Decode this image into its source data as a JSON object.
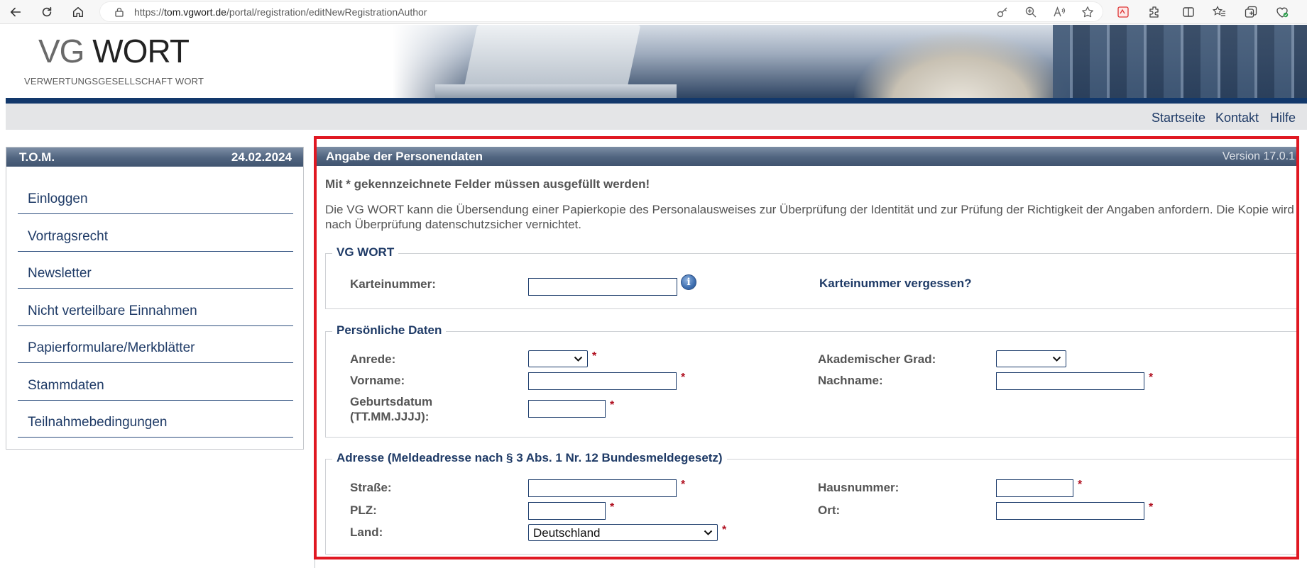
{
  "browser": {
    "url_prefix": "https://",
    "url_host": "tom.vgwort.de",
    "url_path": "/portal/registration/editNewRegistrationAuthor"
  },
  "header": {
    "logo_vg": "VG",
    "logo_wort": "WORT",
    "logo_subtitle": "VERWERTUNGSGESELLSCHAFT WORT"
  },
  "top_nav": {
    "items": [
      "Startseite",
      "Kontakt",
      "Hilfe"
    ]
  },
  "sidebar": {
    "title": "T.O.M.",
    "date": "24.02.2024",
    "items": [
      "Einloggen",
      "Vortragsrecht",
      "Newsletter",
      "Nicht verteilbare Einnahmen",
      "Papierformulare/Merkblätter",
      "Stammdaten",
      "Teilnahmebedingungen"
    ]
  },
  "main": {
    "title": "Angabe der Personendaten",
    "version": "Version 17.0.1",
    "required_note": "Mit * gekennzeichnete Felder müssen ausgefüllt werden!",
    "intro": "Die VG WORT kann die Übersendung einer Papierkopie des Personalausweises zur Überprüfung der Identität und zur Prüfung der Richtigkeit der Angaben anfordern. Die Kopie wird nach Überprüfung datenschutzsicher vernichtet.",
    "required_mark": "*",
    "info_glyph": "i",
    "vgwort_section": {
      "legend": "VG WORT",
      "karteinummer_label": "Karteinummer:",
      "karteinummer_value": "",
      "forgot_link": "Karteinummer vergessen?"
    },
    "personal_section": {
      "legend": "Persönliche Daten",
      "anrede_label": "Anrede:",
      "anrede_value": "",
      "grad_label": "Akademischer Grad:",
      "grad_value": "",
      "vorname_label": "Vorname:",
      "vorname_value": "",
      "nachname_label": "Nachname:",
      "nachname_value": "",
      "geburtsdatum_label_1": "Geburtsdatum",
      "geburtsdatum_label_2": "(TT.MM.JJJJ):",
      "geburtsdatum_value": ""
    },
    "address_section": {
      "legend": "Adresse (Meldeadresse nach § 3 Abs. 1 Nr. 12 Bundesmeldegesetz)",
      "strasse_label": "Straße:",
      "strasse_value": "",
      "hausnummer_label": "Hausnummer:",
      "hausnummer_value": "",
      "plz_label": "PLZ:",
      "plz_value": "",
      "ort_label": "Ort:",
      "ort_value": "",
      "land_label": "Land:",
      "land_value": "Deutschland"
    }
  },
  "colors": {
    "accent_navy": "#1e3a66",
    "highlight_red": "#e01822",
    "required_red": "#b01020"
  }
}
